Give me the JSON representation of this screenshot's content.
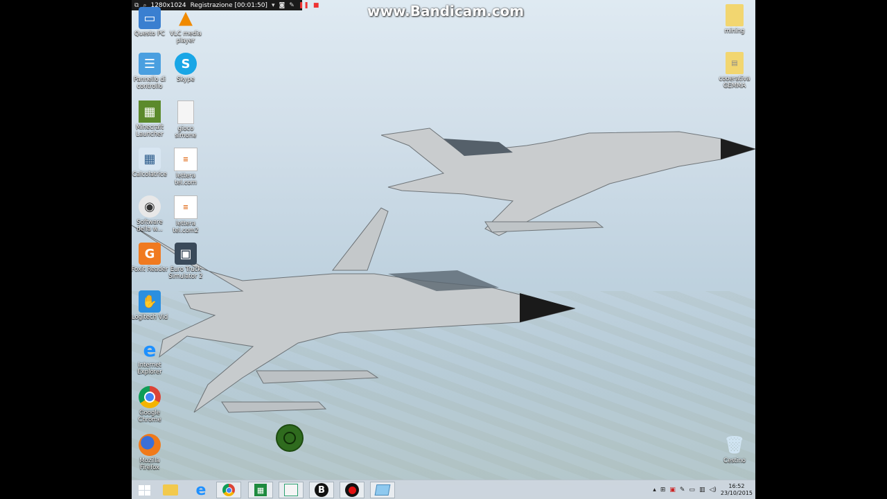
{
  "recorder": {
    "resolution": "1280x1024",
    "status": "Registrazione [00:01:50]"
  },
  "watermark": "www.Bandicam.com",
  "desktop_icons_left": [
    {
      "label": "Questo PC",
      "icon": "computer-icon"
    },
    {
      "label": "VLC media player",
      "icon": "vlc-icon"
    },
    {
      "label": "Pannello di controllo",
      "icon": "control-panel-icon"
    },
    {
      "label": "Skype",
      "icon": "skype-icon"
    },
    {
      "label": "Minecraft Launcher",
      "icon": "minecraft-icon"
    },
    {
      "label": "gioco simone",
      "icon": "file-icon"
    },
    {
      "label": "Calcolatrice",
      "icon": "calculator-icon"
    },
    {
      "label": "lettera tel.com",
      "icon": "document-icon"
    },
    {
      "label": "Software della w...",
      "icon": "webcam-icon"
    },
    {
      "label": "lettera tel.com2",
      "icon": "document-icon"
    },
    {
      "label": "Foxit Reader",
      "icon": "pdf-icon"
    },
    {
      "label": "Euro Truck Simulator 2",
      "icon": "truck-icon"
    },
    {
      "label": "Logitech Vid",
      "icon": "logitech-icon"
    },
    {
      "label": "Internet Explorer",
      "icon": "ie-icon"
    },
    {
      "label": "Google Chrome",
      "icon": "chrome-icon"
    },
    {
      "label": "Mozilla Firefox",
      "icon": "firefox-icon"
    }
  ],
  "desktop_icons_right": [
    {
      "label": "mining",
      "icon": "folder-icon"
    },
    {
      "label": "cooerativa GEMMA",
      "icon": "folder-icon"
    },
    {
      "label": "Cestino",
      "icon": "recycle-bin-icon"
    }
  ],
  "taskbar": {
    "apps": [
      "start-icon",
      "file-explorer-icon",
      "ie-icon",
      "chrome-icon",
      "excel-icon",
      "notepad-icon",
      "bandicam-b-icon",
      "record-icon",
      "window-icon"
    ],
    "clock_time": "16:52",
    "clock_date": "23/10/2015"
  }
}
